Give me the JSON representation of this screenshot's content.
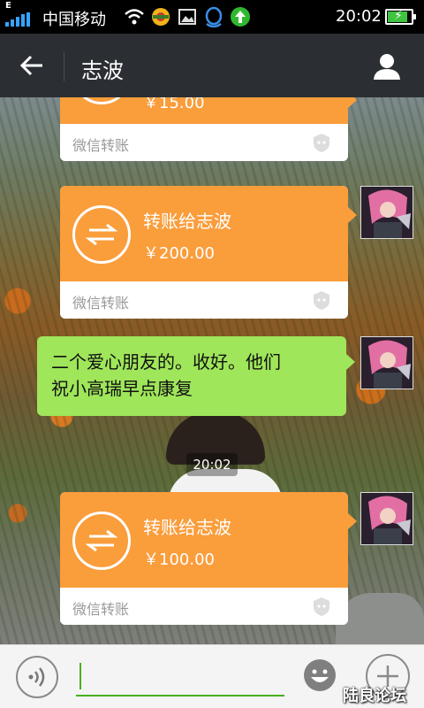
{
  "status_bar": {
    "network_type": "E",
    "carrier": "中国移动",
    "time": "20:02",
    "battery_level": 0.85,
    "signal_color": "#36a3ff",
    "icons": [
      "wifi-icon",
      "app-notification-icon",
      "image-icon",
      "qq-icon",
      "upload-icon"
    ]
  },
  "header": {
    "title": "志波",
    "back_icon": "arrow-left-icon",
    "profile_icon": "person-icon",
    "background": "#2b2f33"
  },
  "messages": {
    "transfer_1": {
      "amount": "￥15.00",
      "footer": "微信转账"
    },
    "transfer_2": {
      "title": "转账给志波",
      "amount": "￥200.00",
      "footer": "微信转账"
    },
    "text_1": {
      "line1": "二个爱心朋友的。收好。他们",
      "line2": "祝小高瑞早点康复"
    },
    "time_divider": "20:02",
    "transfer_3": {
      "title": "转账给志波",
      "amount": "￥100.00",
      "footer": "微信转账"
    }
  },
  "colors": {
    "transfer_orange": "#fa9d3b",
    "text_bubble_green": "#9fe65a",
    "input_accent": "#46b01e"
  },
  "input_bar": {
    "voice_icon": "voice-icon",
    "emoji_icon": "emoji-icon",
    "plus_icon": "plus-icon",
    "value": ""
  },
  "watermark": "陆良论坛"
}
